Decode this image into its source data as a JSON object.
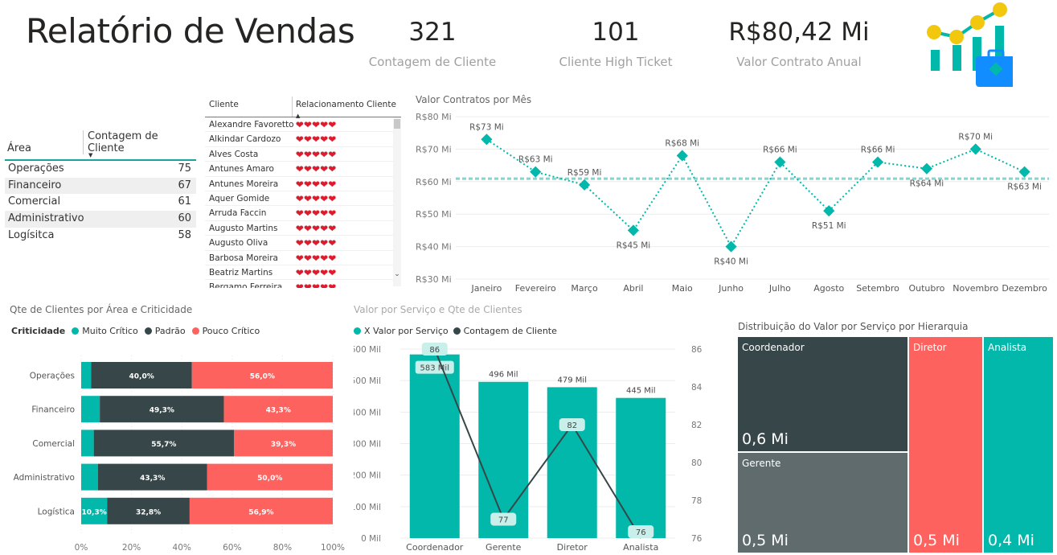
{
  "header": {
    "title": "Relatório de Vendas"
  },
  "kpis": [
    {
      "value": "321",
      "label": "Contagem de Cliente"
    },
    {
      "value": "101",
      "label": "Cliente High Ticket"
    },
    {
      "value": "R$80,42 Mi",
      "label": "Valor Contrato Anual"
    }
  ],
  "logo": {
    "icon": "sales-analytics-icon",
    "colors": [
      "#01b8aa",
      "#f2c80f",
      "#118dff"
    ]
  },
  "area_table": {
    "col1": "Área",
    "col2": "Contagem de Cliente",
    "rows": [
      {
        "area": "Operações",
        "count": "75"
      },
      {
        "area": "Financeiro",
        "count": "67"
      },
      {
        "area": "Comercial",
        "count": "61"
      },
      {
        "area": "Administrativo",
        "count": "60"
      },
      {
        "area": "Logísitca",
        "count": "58"
      }
    ]
  },
  "client_table": {
    "col1": "Cliente",
    "col2": "Relacionamento Cliente",
    "hearts": "❤❤❤❤❤",
    "rows": [
      "Alexandre Favoretto",
      "Alkindar Cardozo",
      "Alves Costa",
      "Antunes Amaro",
      "Antunes Moreira",
      "Aquer Gomide",
      "Arruda Faccin",
      "Augusto Martins",
      "Augusto Oliva",
      "Barbosa Moreira",
      "Beatriz Martins",
      "Bergamo Ferreira"
    ]
  },
  "colors": {
    "teal": "#01b8aa",
    "dark": "#374649",
    "red": "#fd625e",
    "gray": "#5f6b6d"
  },
  "chart_data": [
    {
      "id": "line",
      "type": "line",
      "title": "Valor Contratos por Mês",
      "categories": [
        "Janeiro",
        "Fevereiro",
        "Março",
        "Abril",
        "Maio",
        "Junho",
        "Julho",
        "Agosto",
        "Setembro",
        "Outubro",
        "Novembro",
        "Dezembro"
      ],
      "values": [
        73,
        63,
        59,
        45,
        68,
        40,
        66,
        51,
        66,
        64,
        70,
        63
      ],
      "labels": [
        "R$73 Mi",
        "R$63 Mi",
        "R$59 Mi",
        "R$45 Mi",
        "R$68 Mi",
        "R$40 Mi",
        "R$66 Mi",
        "R$51 Mi",
        "R$66 Mi",
        "R$64 Mi",
        "R$70 Mi",
        "R$63 Mi"
      ],
      "label_pos": [
        "above",
        "above",
        "above",
        "below",
        "above",
        "below",
        "above",
        "below",
        "above",
        "below",
        "above",
        "below"
      ],
      "yticks": [
        "R$30 Mi",
        "R$40 Mi",
        "R$50 Mi",
        "R$60 Mi",
        "R$70 Mi",
        "R$80 Mi"
      ],
      "ylim": [
        30,
        80
      ],
      "average_line": 60.9,
      "grid": true
    },
    {
      "id": "stacked",
      "type": "bar",
      "title": "Qte de Clientes por Área e Criticidade",
      "legend_title": "Criticidade",
      "categories": [
        "Operações",
        "Financeiro",
        "Comercial",
        "Administrativo",
        "Logística"
      ],
      "series": [
        {
          "name": "Muito Crítico",
          "values": [
            4.0,
            7.4,
            5.0,
            6.7,
            10.3
          ],
          "labels": [
            "",
            "",
            "",
            "",
            "10,3%"
          ]
        },
        {
          "name": "Padrão",
          "values": [
            40.0,
            49.3,
            55.7,
            43.3,
            32.8
          ],
          "labels": [
            "40,0%",
            "49,3%",
            "55,7%",
            "43,3%",
            "32,8%"
          ]
        },
        {
          "name": "Pouco Crítico",
          "values": [
            56.0,
            43.3,
            39.3,
            50.0,
            56.9
          ],
          "labels": [
            "56,0%",
            "43,3%",
            "39,3%",
            "50,0%",
            "56,9%"
          ]
        }
      ],
      "xticks": [
        "0%",
        "20%",
        "40%",
        "60%",
        "80%",
        "100%"
      ],
      "xlim": [
        0,
        100
      ]
    },
    {
      "id": "combo",
      "type": "bar",
      "title": "Valor por Serviço e Qte de Clientes",
      "categories": [
        "Coordenador",
        "Gerente",
        "Diretor",
        "Analista"
      ],
      "series": [
        {
          "name": "X Valor por Serviço",
          "values": [
            583,
            496,
            479,
            445
          ],
          "labels": [
            "583 Mil",
            "496 Mil",
            "479 Mil",
            "445 Mil"
          ]
        },
        {
          "name": "Contagem de Cliente",
          "values": [
            86,
            77,
            82,
            76
          ],
          "labels": [
            "86",
            "77",
            "82",
            "76"
          ]
        }
      ],
      "yticks": [
        "0 Mil",
        "100 Mil",
        "200 Mil",
        "300 Mil",
        "400 Mil",
        "500 Mil",
        "600 Mil"
      ],
      "ylim": [
        0,
        600
      ],
      "y2ticks": [
        "76",
        "78",
        "80",
        "82",
        "84",
        "86"
      ],
      "y2lim": [
        76,
        86
      ]
    },
    {
      "id": "treemap",
      "type": "treemap",
      "title": "Distribuição do Valor por Serviço por Hierarquia",
      "items": [
        {
          "name": "Coordenador",
          "value": 0.6,
          "label": "0,6 Mi"
        },
        {
          "name": "Gerente",
          "value": 0.5,
          "label": "0,5 Mi"
        },
        {
          "name": "Diretor",
          "value": 0.5,
          "label": "0,5 Mi"
        },
        {
          "name": "Analista",
          "value": 0.4,
          "label": "0,4 Mi"
        }
      ]
    }
  ]
}
